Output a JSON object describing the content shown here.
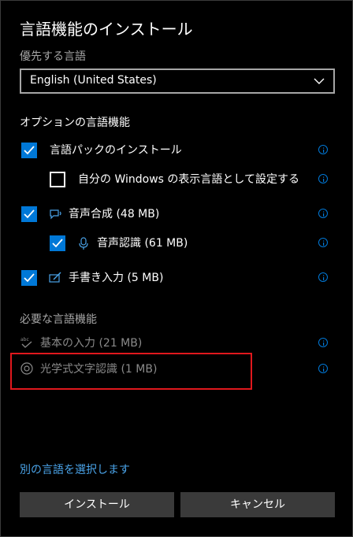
{
  "dialog": {
    "title": "言語機能のインストール",
    "preferred_language_label": "優先する言語",
    "preferred_language_value": "English (United States)",
    "optional_section_label": "オプションの言語機能",
    "optional_features": [
      {
        "label": "言語パックのインストール",
        "checked": true
      },
      {
        "label": "自分の Windows の表示言語として設定する",
        "checked": false
      },
      {
        "label": "音声合成 (48 MB)",
        "checked": true,
        "icon": "speech-synthesis-icon"
      },
      {
        "label": "音声認識 (61 MB)",
        "checked": true,
        "icon": "microphone-icon"
      },
      {
        "label": "手書き入力 (5 MB)",
        "checked": true,
        "icon": "handwriting-pen-icon"
      }
    ],
    "required_section_label": "必要な言語機能",
    "required_features": [
      {
        "label": "基本の入力 (21 MB)",
        "icon": "abc-check-icon"
      },
      {
        "label": "光学式文字認識 (1 MB)",
        "icon": "ocr-icon"
      }
    ],
    "choose_other_language_link": "別の言語を選択します",
    "install_button": "インストール",
    "cancel_button": "キャンセル"
  },
  "colors": {
    "accent": "#0078d7",
    "highlight_box": "#e0181d",
    "link": "#4aa3e8",
    "button_bg": "#3a3a3a",
    "muted_text": "#a6a6a6"
  }
}
